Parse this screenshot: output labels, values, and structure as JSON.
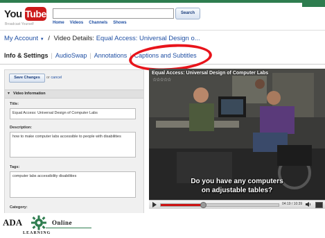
{
  "header": {
    "logo_you": "You",
    "logo_tube": "Tube",
    "logo_tagline": "Broadcast Yourself",
    "search_button": "Search",
    "nav": [
      "Home",
      "Videos",
      "Channels",
      "Shows"
    ]
  },
  "breadcrumb": {
    "account": "My Account",
    "label": "Video Details:",
    "video_title": "Equal Access: Universal Design o..."
  },
  "tabs": [
    {
      "label": "Info & Settings",
      "active": true
    },
    {
      "label": "AudioSwap",
      "active": false
    },
    {
      "label": "Annotations",
      "active": false
    },
    {
      "label": "Captions and Subtitles",
      "active": false
    }
  ],
  "form": {
    "save_button": "Save Changes",
    "or_text": "or",
    "cancel_link": "cancel",
    "section_title": "Video Information",
    "title_label": "Title:",
    "title_value": "Equal Access: Universal Design of Computer Labs",
    "description_label": "Description:",
    "description_value": "how to make computer labs accessible to people with disabilities",
    "tags_label": "Tags:",
    "tags_value": "computer labs accessibility disabilities",
    "category_label": "Category:"
  },
  "video": {
    "overlay_title": "Equal Access: Universal Design of Computer Labs",
    "rating_stars": "☆☆☆☆☆",
    "caption_line1": "Do you have any computers",
    "caption_line2": "on adjustable tables?",
    "time": "04:19 / 10:39",
    "progress": 0.36
  },
  "branding": {
    "ada_left": "ADA",
    "ada_right": "Online",
    "ada_sub": "LEARNING"
  },
  "colors": {
    "link_blue": "#1f4fa3",
    "highlight_red": "#e8141b",
    "brand_green": "#2e7d4f"
  }
}
